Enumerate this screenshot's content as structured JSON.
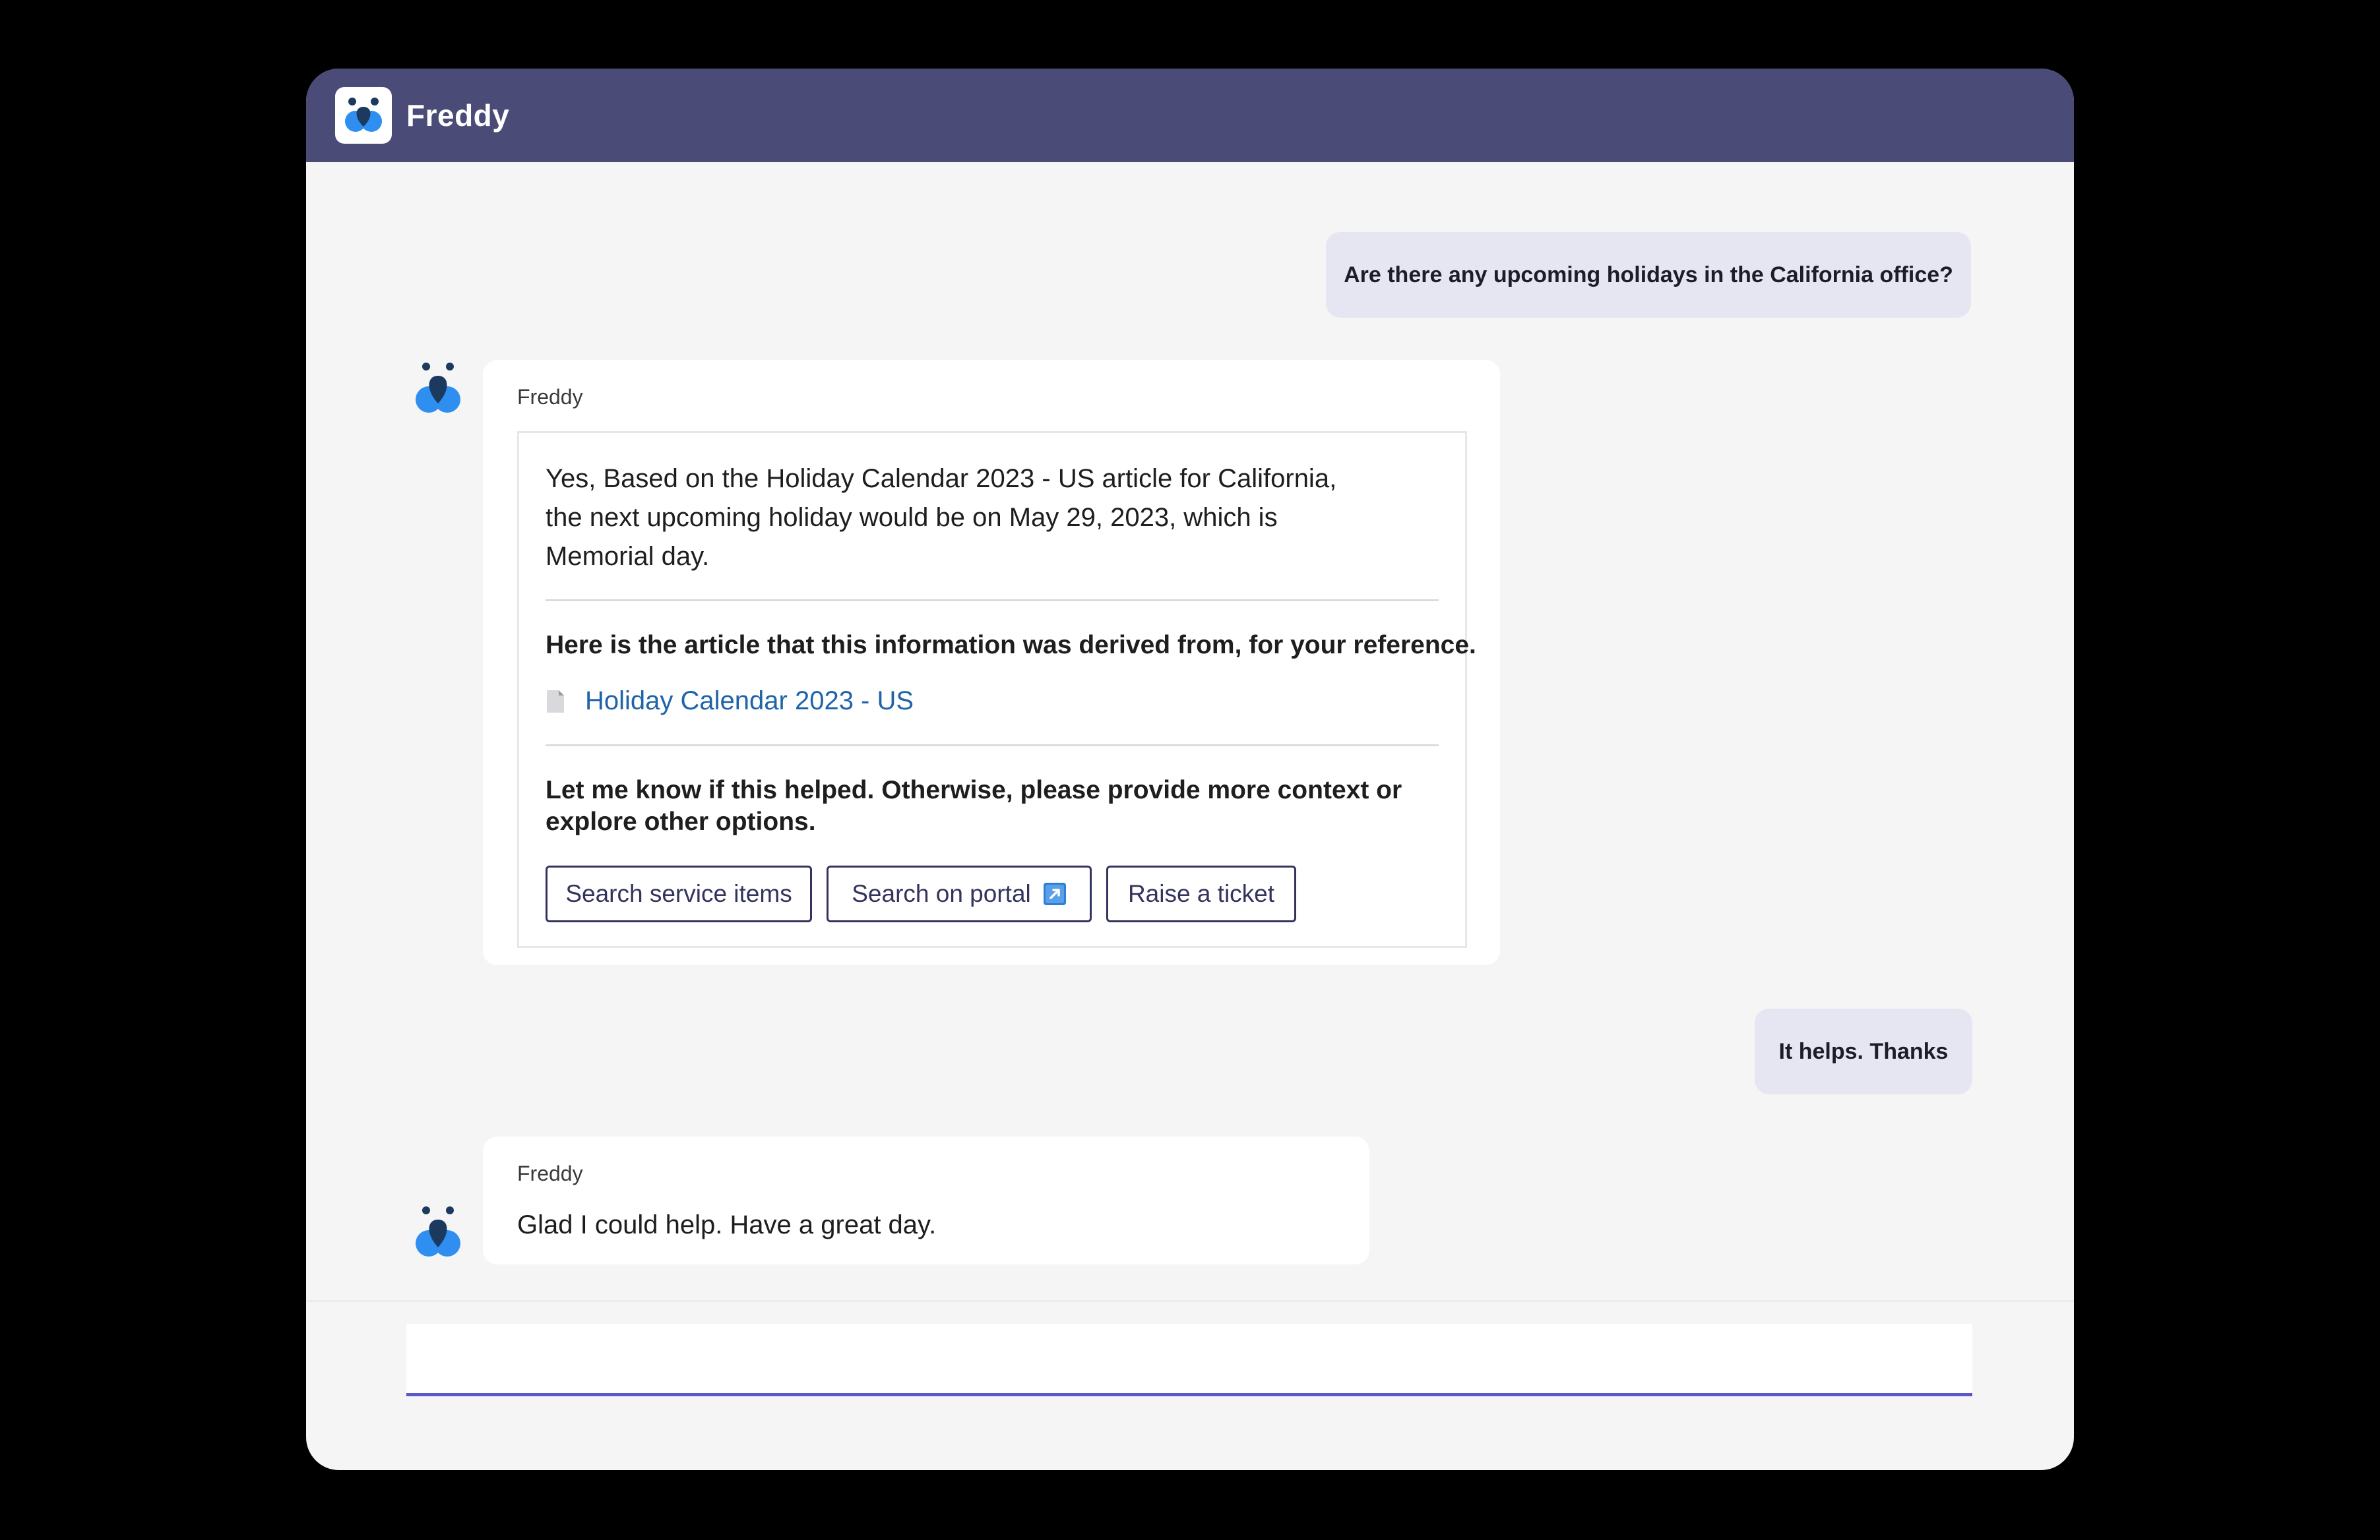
{
  "app": {
    "name": "Freddy"
  },
  "conversation": {
    "user_message_1": "Are there any upcoming holidays in the California office?",
    "bot_message_1": {
      "sender": "Freddy",
      "answer": "Yes, Based on the Holiday Calendar 2023 - US article for California, the next upcoming holiday would be on May 29, 2023, which is Memorial day.",
      "reference_heading": "Here is the article that this information was derived from, for your reference.",
      "article_link": "Holiday Calendar 2023 - US",
      "followup_text": "Let me know if this helped. Otherwise, please provide more context or explore other options.",
      "buttons": {
        "search_service_items": "Search service items",
        "search_on_portal": "Search on portal",
        "raise_ticket": "Raise a ticket"
      }
    },
    "user_message_2": "It helps. Thanks",
    "bot_message_2": {
      "sender": "Freddy",
      "text": "Glad I could help. Have a great day."
    }
  },
  "composer": {
    "placeholder": ""
  },
  "colors": {
    "titlebar": "#4b4b78",
    "user_bubble": "#e6e6f2",
    "link": "#1f63a8",
    "button_border": "#33335e",
    "logo_blue": "#2f8ff0",
    "logo_dark": "#1c3a5e",
    "composer_underline": "#5b57c8"
  },
  "icons": {
    "logo": "freddy-logo-icon",
    "bot_avatar": "freddy-avatar-icon",
    "article": "document-icon",
    "external": "external-link-icon"
  }
}
